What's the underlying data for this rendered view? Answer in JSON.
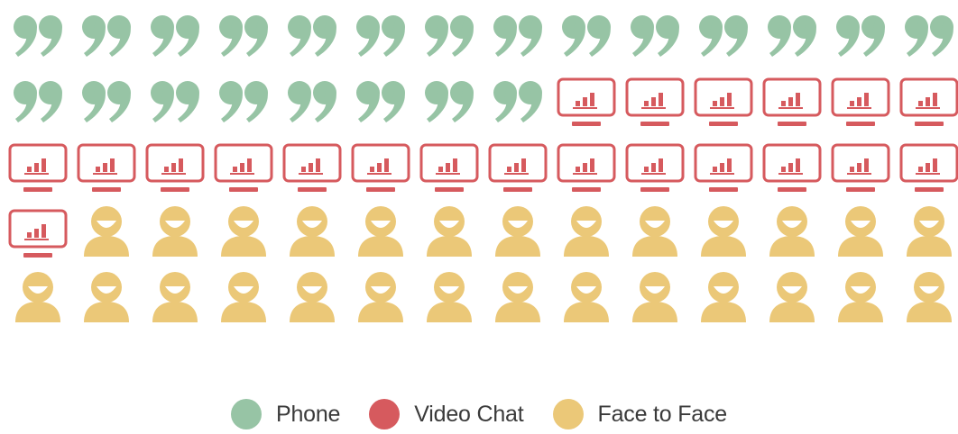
{
  "chart_data": {
    "type": "waffle",
    "columns": 14,
    "series": [
      {
        "name": "Phone",
        "count": 22,
        "icon": "quote-icon",
        "color": "#97c4a5"
      },
      {
        "name": "Video Chat",
        "count": 21,
        "icon": "monitor-chart-icon",
        "color": "#d65a5e"
      },
      {
        "name": "Face to Face",
        "count": 27,
        "icon": "person-icon",
        "color": "#ebc878"
      }
    ],
    "legend_position": "bottom",
    "grid": false
  },
  "legend": [
    {
      "label": "Phone",
      "color": "#97c4a5"
    },
    {
      "label": "Video Chat",
      "color": "#d65a5e"
    },
    {
      "label": "Face to Face",
      "color": "#ebc878"
    }
  ]
}
